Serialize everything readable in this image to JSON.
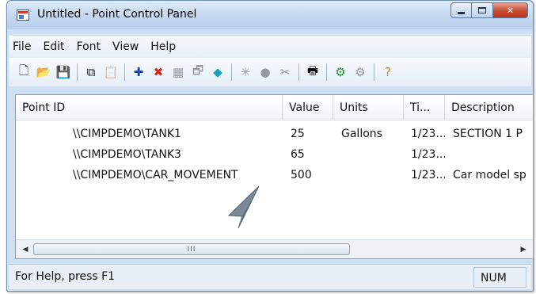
{
  "window": {
    "title": "Untitled - Point Control Panel"
  },
  "menu": [
    "File",
    "Edit",
    "Font",
    "View",
    "Help"
  ],
  "toolbar": {
    "buttons": [
      {
        "icon": "new-document-icon",
        "glyph": "🗋",
        "enabled": true
      },
      {
        "icon": "open-folder-icon",
        "glyph": "📂",
        "enabled": true
      },
      {
        "icon": "save-icon",
        "glyph": "💾",
        "enabled": true
      },
      {
        "icon": "copy-icon",
        "glyph": "⧉",
        "enabled": true
      },
      {
        "icon": "paste-icon",
        "glyph": "📋",
        "enabled": false
      },
      {
        "icon": "add-point-icon",
        "glyph": "✚",
        "enabled": true,
        "color": "#1f3fbf"
      },
      {
        "icon": "delete-point-icon",
        "glyph": "✖",
        "enabled": true,
        "color": "#d8261c"
      },
      {
        "icon": "point-table-icon",
        "glyph": "▦",
        "enabled": false
      },
      {
        "icon": "point-properties-icon",
        "glyph": "🗗",
        "enabled": false
      },
      {
        "icon": "connect-icon",
        "glyph": "◆",
        "enabled": true,
        "color": "#17a3b8"
      },
      {
        "icon": "alarm-ack-icon",
        "glyph": "✳",
        "enabled": false
      },
      {
        "icon": "record-icon",
        "glyph": "●",
        "enabled": false
      },
      {
        "icon": "cut-icon",
        "glyph": "✂",
        "enabled": false
      },
      {
        "icon": "print-icon",
        "glyph": "🖶",
        "enabled": true
      },
      {
        "icon": "set-value-icon",
        "glyph": "⚙",
        "enabled": true,
        "color": "#2a8a3a"
      },
      {
        "icon": "reset-value-icon",
        "glyph": "⚙",
        "enabled": false
      },
      {
        "icon": "help-icon",
        "glyph": "?",
        "enabled": true,
        "color": "#c08a00"
      }
    ]
  },
  "list": {
    "columns": [
      "Point ID",
      "Value",
      "Units",
      "Ti...",
      "Description"
    ],
    "rows": [
      {
        "point_id": "\\\\CIMPDEMO\\TANK1",
        "value": "25",
        "units": "Gallons",
        "time": "1/23...",
        "description": "SECTION 1 P"
      },
      {
        "point_id": "\\\\CIMPDEMO\\TANK3",
        "value": "65",
        "units": "",
        "time": "1/23...",
        "description": ""
      },
      {
        "point_id": "\\\\CIMPDEMO\\CAR_MOVEMENT",
        "value": "500",
        "units": "",
        "time": "1/23...",
        "description": "Car model sp"
      }
    ],
    "scrollbar_thumb_label": "III",
    "scroll_left": "◀",
    "scroll_right": "▶"
  },
  "status": {
    "text": "For Help, press F1",
    "indicator": "NUM"
  }
}
